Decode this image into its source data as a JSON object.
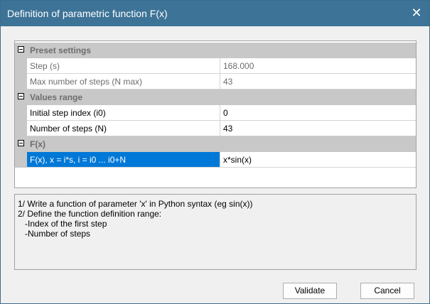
{
  "window": {
    "title": "Definition of parametric function F(x)",
    "close_label": "✕"
  },
  "grid": {
    "categories": [
      {
        "label": "Preset settings",
        "rows": [
          {
            "name": "Step (s)",
            "value": "168.000",
            "readonly": true
          },
          {
            "name": "Max number of steps (N max)",
            "value": "43",
            "readonly": true
          }
        ]
      },
      {
        "label": "Values range",
        "rows": [
          {
            "name": "Initial step index (i0)",
            "value": "0",
            "readonly": false
          },
          {
            "name": "Number of steps (N)",
            "value": "43",
            "readonly": false
          }
        ]
      },
      {
        "label": "F(x)",
        "rows": [
          {
            "name": "F(x), x = i*s, i = i0 ... i0+N",
            "value": "x*sin(x)",
            "readonly": false,
            "selected": true
          }
        ]
      }
    ]
  },
  "description": {
    "lines": [
      "1/ Write a function of parameter 'x' in Python syntax (eg sin(x))",
      "2/ Define the function definition range:",
      "   -Index of the first step",
      "   -Number of steps"
    ]
  },
  "buttons": {
    "validate": "Validate",
    "cancel": "Cancel"
  }
}
